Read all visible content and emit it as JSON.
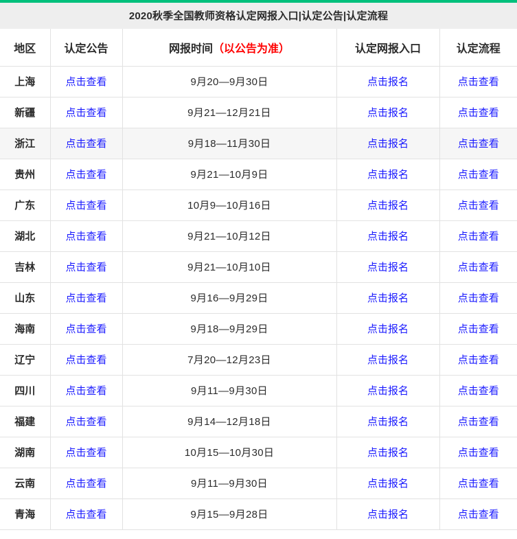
{
  "accent_color": "#00c07c",
  "link_color": "#1a1aff",
  "highlight_color": "#f6f6f6",
  "header": {
    "title": "2020秋季全国教师资格认定网报入口|认定公告|认定流程"
  },
  "table": {
    "columns": [
      {
        "key": "region",
        "label": "地区"
      },
      {
        "key": "notice",
        "label": "认定公告"
      },
      {
        "key": "time",
        "label": "网报时间",
        "note": "（以公告为准）"
      },
      {
        "key": "entry",
        "label": "认定网报入口"
      },
      {
        "key": "process",
        "label": "认定流程"
      }
    ],
    "rows": [
      {
        "region": "上海",
        "notice": "点击查看",
        "time": "9月20—9月30日",
        "entry": "点击报名",
        "process": "点击查看",
        "highlighted": false
      },
      {
        "region": "新疆",
        "notice": "点击查看",
        "time": "9月21—12月21日",
        "entry": "点击报名",
        "process": "点击查看",
        "highlighted": false
      },
      {
        "region": "浙江",
        "notice": "点击查看",
        "time": "9月18—11月30日",
        "entry": "点击报名",
        "process": "点击查看",
        "highlighted": true
      },
      {
        "region": "贵州",
        "notice": "点击查看",
        "time": "9月21—10月9日",
        "entry": "点击报名",
        "process": "点击查看",
        "highlighted": false
      },
      {
        "region": "广东",
        "notice": "点击查看",
        "time": "10月9—10月16日",
        "entry": "点击报名",
        "process": "点击查看",
        "highlighted": false
      },
      {
        "region": "湖北",
        "notice": "点击查看",
        "time": "9月21—10月12日",
        "entry": "点击报名",
        "process": "点击查看",
        "highlighted": false
      },
      {
        "region": "吉林",
        "notice": "点击查看",
        "time": "9月21—10月10日",
        "entry": "点击报名",
        "process": "点击查看",
        "highlighted": false
      },
      {
        "region": "山东",
        "notice": "点击查看",
        "time": "9月16—9月29日",
        "entry": "点击报名",
        "process": "点击查看",
        "highlighted": false
      },
      {
        "region": "海南",
        "notice": "点击查看",
        "time": "9月18—9月29日",
        "entry": "点击报名",
        "process": "点击查看",
        "highlighted": false
      },
      {
        "region": "辽宁",
        "notice": "点击查看",
        "time": "7月20—12月23日",
        "entry": "点击报名",
        "process": "点击查看",
        "highlighted": false
      },
      {
        "region": "四川",
        "notice": "点击查看",
        "time": "9月11—9月30日",
        "entry": "点击报名",
        "process": "点击查看",
        "highlighted": false
      },
      {
        "region": "福建",
        "notice": "点击查看",
        "time": "9月14—12月18日",
        "entry": "点击报名",
        "process": "点击查看",
        "highlighted": false
      },
      {
        "region": "湖南",
        "notice": "点击查看",
        "time": "10月15—10月30日",
        "entry": "点击报名",
        "process": "点击查看",
        "highlighted": false
      },
      {
        "region": "云南",
        "notice": "点击查看",
        "time": "9月11—9月30日",
        "entry": "点击报名",
        "process": "点击查看",
        "highlighted": false
      },
      {
        "region": "青海",
        "notice": "点击查看",
        "time": "9月15—9月28日",
        "entry": "点击报名",
        "process": "点击查看",
        "highlighted": false
      }
    ]
  }
}
